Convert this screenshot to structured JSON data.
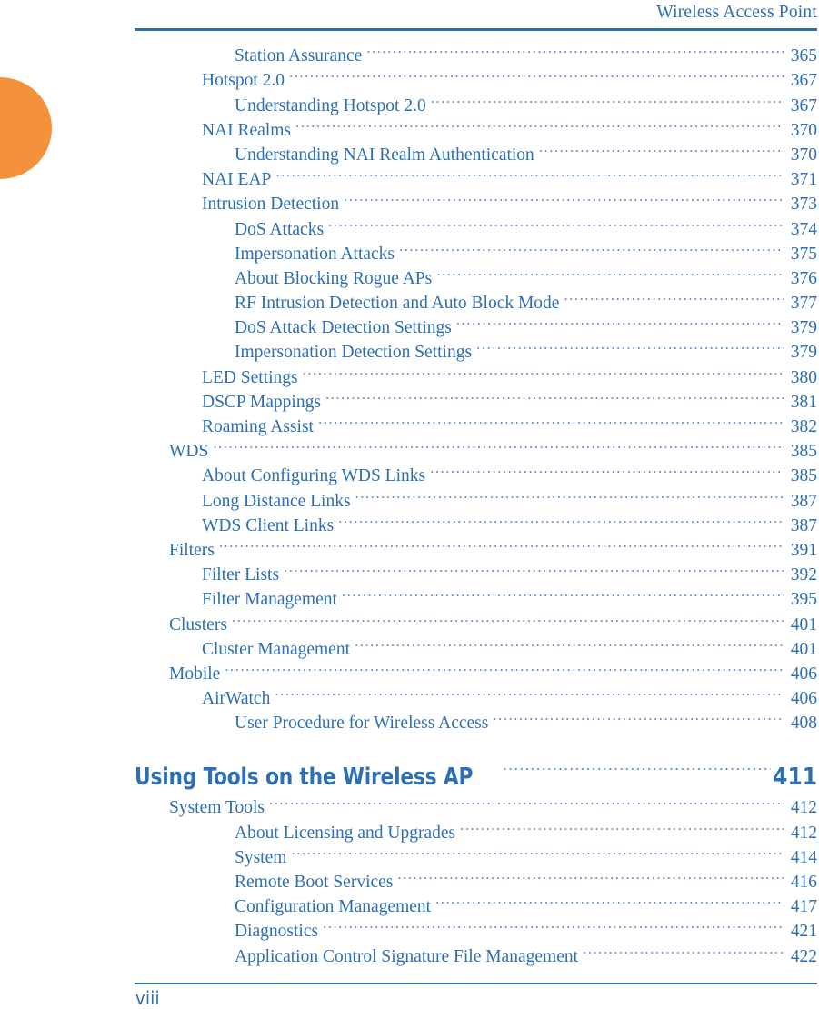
{
  "header": {
    "title": "Wireless Access Point",
    "rule_color": "#2C6FB5"
  },
  "decoration": {
    "orange_tab_color": "#F4923B"
  },
  "colors": {
    "text_blue": "#2C6FB5",
    "leader_blue": "#5E93C6",
    "accent_orange": "#F4923B"
  },
  "toc": {
    "entries": [
      {
        "level": 3,
        "title": "Station Assurance",
        "page": "365"
      },
      {
        "level": 2,
        "title": "Hotspot 2.0",
        "page": "367"
      },
      {
        "level": 3,
        "title": "Understanding Hotspot 2.0",
        "page": "367"
      },
      {
        "level": 2,
        "title": "NAI Realms",
        "page": "370"
      },
      {
        "level": 3,
        "title": "Understanding NAI Realm Authentication",
        "page": "370"
      },
      {
        "level": 2,
        "title": "NAI EAP",
        "page": "371"
      },
      {
        "level": 2,
        "title": "Intrusion Detection",
        "page": "373"
      },
      {
        "level": 3,
        "title": "DoS Attacks",
        "page": "374"
      },
      {
        "level": 3,
        "title": "Impersonation Attacks",
        "page": "375"
      },
      {
        "level": 3,
        "title": "About Blocking Rogue APs",
        "page": "376"
      },
      {
        "level": 3,
        "title": "RF Intrusion Detection and Auto Block Mode",
        "page": "377"
      },
      {
        "level": 3,
        "title": "DoS Attack Detection Settings",
        "page": "379"
      },
      {
        "level": 3,
        "title": "Impersonation Detection Settings",
        "page": "379"
      },
      {
        "level": 2,
        "title": "LED Settings",
        "page": "380"
      },
      {
        "level": 2,
        "title": "DSCP Mappings",
        "page": "381"
      },
      {
        "level": 2,
        "title": "Roaming Assist",
        "page": "382"
      },
      {
        "level": 1,
        "title": "WDS",
        "page": "385"
      },
      {
        "level": 2,
        "title": "About Configuring WDS Links",
        "page": "385"
      },
      {
        "level": 2,
        "title": "Long Distance Links",
        "page": "387"
      },
      {
        "level": 2,
        "title": "WDS Client Links",
        "page": "387"
      },
      {
        "level": 1,
        "title": "Filters",
        "page": "391"
      },
      {
        "level": 2,
        "title": "Filter Lists",
        "page": "392"
      },
      {
        "level": 2,
        "title": "Filter Management",
        "page": "395"
      },
      {
        "level": 1,
        "title": "Clusters",
        "page": "401"
      },
      {
        "level": 2,
        "title": "Cluster Management",
        "page": "401"
      },
      {
        "level": 1,
        "title": "Mobile",
        "page": "406"
      },
      {
        "level": 2,
        "title": "AirWatch",
        "page": "406"
      },
      {
        "level": 3,
        "title": "User Procedure for Wireless Access",
        "page": "408"
      },
      {
        "level": 0,
        "title": "Using Tools on the Wireless AP",
        "page": "411"
      },
      {
        "level": 1,
        "title": "System Tools",
        "page": "412"
      },
      {
        "level": 3,
        "title": "About Licensing and Upgrades",
        "page": "412"
      },
      {
        "level": 3,
        "title": "System",
        "page": "414"
      },
      {
        "level": 3,
        "title": "Remote Boot Services",
        "page": "416"
      },
      {
        "level": 3,
        "title": "Configuration Management",
        "page": "417"
      },
      {
        "level": 3,
        "title": "Diagnostics",
        "page": "421"
      },
      {
        "level": 3,
        "title": "Application Control Signature File Management",
        "page": "422"
      }
    ]
  },
  "footer": {
    "folio": "viii"
  }
}
